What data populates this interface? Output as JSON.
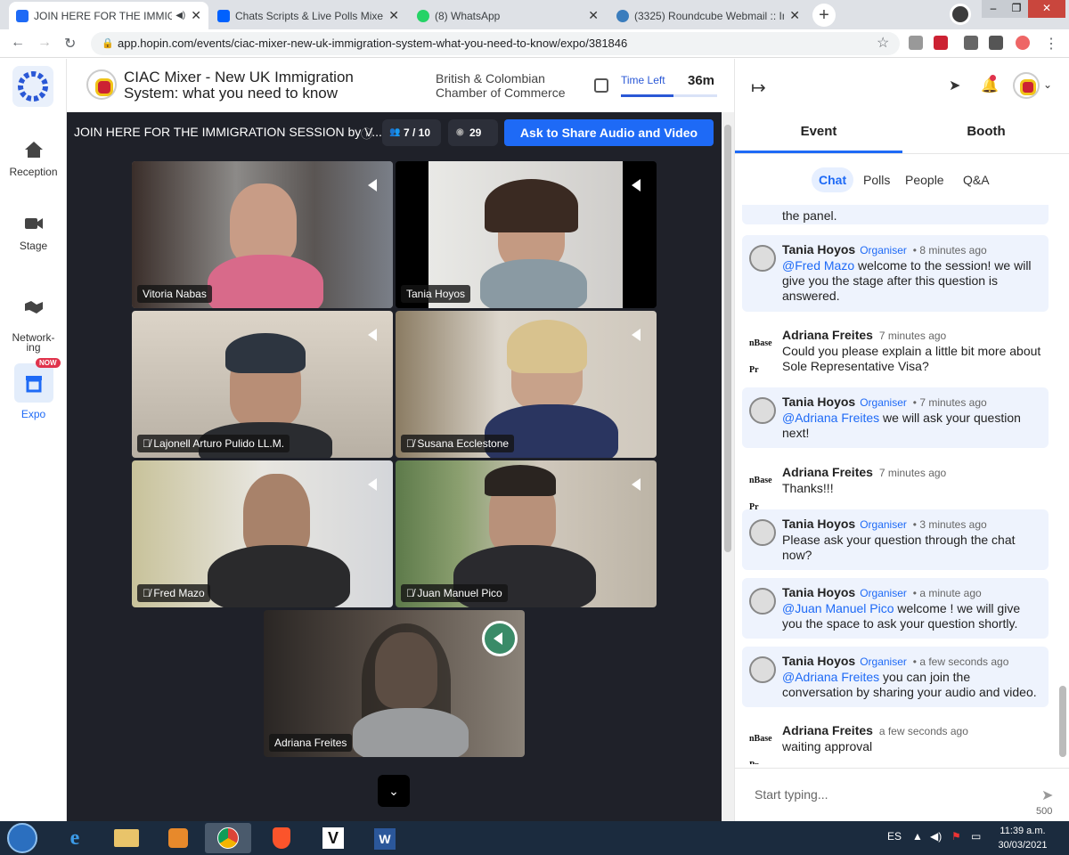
{
  "browser": {
    "tabs": [
      {
        "title": "JOIN HERE FOR THE IMMIGR",
        "active": true
      },
      {
        "title": "Chats Scripts & Live Polls Mixer F"
      },
      {
        "title": "(8) WhatsApp"
      },
      {
        "title": "(3325) Roundcube Webmail :: Inb"
      }
    ],
    "url": "app.hopin.com/events/ciac-mixer-new-uk-immigration-system-what-you-need-to-know/expo/381846"
  },
  "nav": {
    "items": [
      {
        "label": "Reception",
        "icon": "home-icon"
      },
      {
        "label": "Stage",
        "icon": "camera-icon"
      },
      {
        "label": "Network-\ning",
        "icon": "handshake-icon"
      },
      {
        "label": "Expo",
        "icon": "booth-icon",
        "active": true,
        "badge": "NOW"
      }
    ]
  },
  "header": {
    "event_title": "CIAC Mixer - New UK Immigration System: what you need to know",
    "organizer": "British & Colombian Chamber of Commerce",
    "time_left_label": "Time Left",
    "time_left_value": "36m",
    "time_left_fraction": 0.55
  },
  "session": {
    "title": "JOIN HERE FOR THE IMMIGRATION SESSION by V...",
    "participants": "7 / 10",
    "viewers": "29",
    "ask_button": "Ask to Share Audio and Video",
    "tiles": [
      {
        "name": "Vitoria Nabas",
        "muted": false
      },
      {
        "name": "Tania Hoyos",
        "muted": false
      },
      {
        "name": "Lajonell Arturo Pulido LL.M.",
        "muted": true
      },
      {
        "name": "Susana Ecclestone",
        "muted": true
      },
      {
        "name": "Fred Mazo",
        "muted": true
      },
      {
        "name": "Juan Manuel Pico",
        "muted": true
      },
      {
        "name": "Adriana Freites",
        "muted": false,
        "speaking": true
      }
    ]
  },
  "panel": {
    "tabs": [
      "Event",
      "Booth"
    ],
    "subtabs": [
      "Chat",
      "Polls",
      "People",
      "Q&A"
    ],
    "partial_message": "the panel.",
    "messages": [
      {
        "sender": "Tania Hoyos",
        "role": "Organiser",
        "time": "• 8 minutes ago",
        "mention": "@Fred Mazo",
        "text": " welcome to the session! we will give you the stage after this question is answered."
      },
      {
        "sender": "Adriana Freites",
        "role": "",
        "time": "7 minutes ago",
        "mention": "",
        "text": "Could you please explain a little bit more about Sole Representative Visa?"
      },
      {
        "sender": "Tania Hoyos",
        "role": "Organiser",
        "time": "• 7 minutes ago",
        "mention": "@Adriana Freites",
        "text": " we will ask your question next!"
      },
      {
        "sender": "Adriana Freites",
        "role": "",
        "time": "7 minutes ago",
        "mention": "",
        "text": "Thanks!!!"
      },
      {
        "sender": "Tania Hoyos",
        "role": "Organiser",
        "time": "• 3 minutes ago",
        "mention": "",
        "text": "Please ask your question through the chat now?"
      },
      {
        "sender": "Tania Hoyos",
        "role": "Organiser",
        "time": "• a minute ago",
        "mention": "@Juan Manuel Pico",
        "text": " welcome ! we will give you the space to ask your question shortly."
      },
      {
        "sender": "Tania Hoyos",
        "role": "Organiser",
        "time": "• a few seconds ago",
        "mention": "@Adriana Freites",
        "text": " you can join the conversation by sharing your audio and video."
      },
      {
        "sender": "Adriana Freites",
        "role": "",
        "time": "a few seconds ago",
        "mention": "",
        "text": "waiting approval"
      }
    ],
    "avatar_text_nb": "nBase Pr",
    "composer_placeholder": "Start typing...",
    "char_count": "500"
  },
  "taskbar": {
    "lang": "ES",
    "time": "11:39 a.m.",
    "date": "30/03/2021"
  }
}
